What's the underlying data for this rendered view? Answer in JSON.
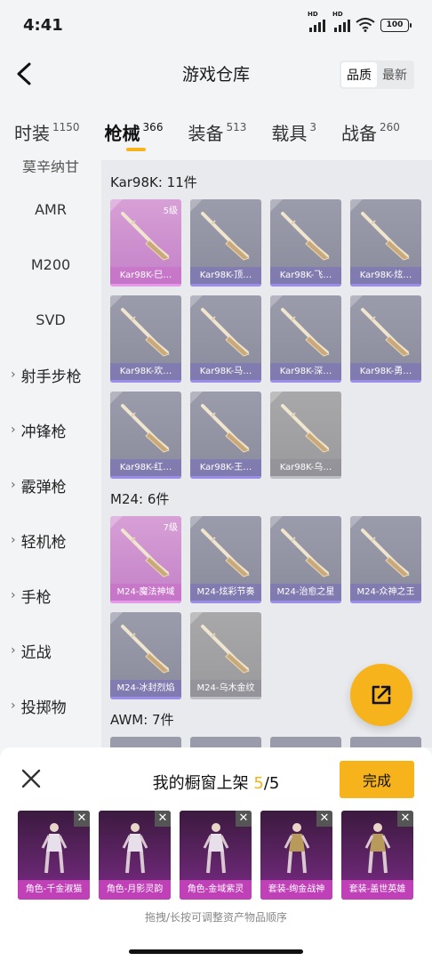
{
  "status": {
    "time": "4:41",
    "battery": "100",
    "net1": "HD",
    "net2": "HD"
  },
  "nav": {
    "title": "游戏仓库",
    "sort": [
      "品质",
      "最新"
    ]
  },
  "tabs": [
    {
      "label": "时装",
      "count": "1150"
    },
    {
      "label": "枪械",
      "count": "366",
      "active": true
    },
    {
      "label": "装备",
      "count": "513"
    },
    {
      "label": "载具",
      "count": "3"
    },
    {
      "label": "战备",
      "count": "260"
    }
  ],
  "sidebar": {
    "cut_item": "莫辛纳甘",
    "items": [
      "AMR",
      "M200",
      "SVD"
    ],
    "groups": [
      "射手步枪",
      "冲锋枪",
      "霰弹枪",
      "轻机枪",
      "手枪",
      "近战",
      "投掷物"
    ]
  },
  "sections": [
    {
      "title": "Kar98K: 11件",
      "cards": [
        {
          "name": "Kar98K-巳…",
          "level": "5级",
          "style": "pink"
        },
        {
          "name": "Kar98K-顶…"
        },
        {
          "name": "Kar98K-飞…"
        },
        {
          "name": "Kar98K-炫…"
        },
        {
          "name": "Kar98K-欢…"
        },
        {
          "name": "Kar98K-马…"
        },
        {
          "name": "Kar98K-深…"
        },
        {
          "name": "Kar98K-勇…"
        },
        {
          "name": "Kar98K-红…"
        },
        {
          "name": "Kar98K-王…"
        },
        {
          "name": "Kar98K-乌…",
          "style": "grey"
        }
      ]
    },
    {
      "title": "M24: 6件",
      "cards": [
        {
          "name": "M24-魔法神域",
          "level": "7级",
          "style": "pink"
        },
        {
          "name": "M24-炫彩节奏"
        },
        {
          "name": "M24-治愈之星"
        },
        {
          "name": "M24-众神之王"
        },
        {
          "name": "M24-冰封烈焰"
        },
        {
          "name": "M24-乌木金纹",
          "style": "grey"
        }
      ]
    },
    {
      "title": "AWM: 7件",
      "cards": []
    }
  ],
  "panel": {
    "title_prefix": "我的橱窗上架 ",
    "count": "5",
    "total": "/5",
    "done": "完成",
    "hint": "拖拽/长按可调整资产物品顺序",
    "items": [
      "角色-千金淑猫",
      "角色-月影灵韵",
      "角色-金域紫灵",
      "套装-绚金战神",
      "套装-盖世英雄"
    ]
  },
  "colors": {
    "accent": "#f6b31c",
    "epic": "#c380c7",
    "legendary": "#9a8ee8"
  }
}
